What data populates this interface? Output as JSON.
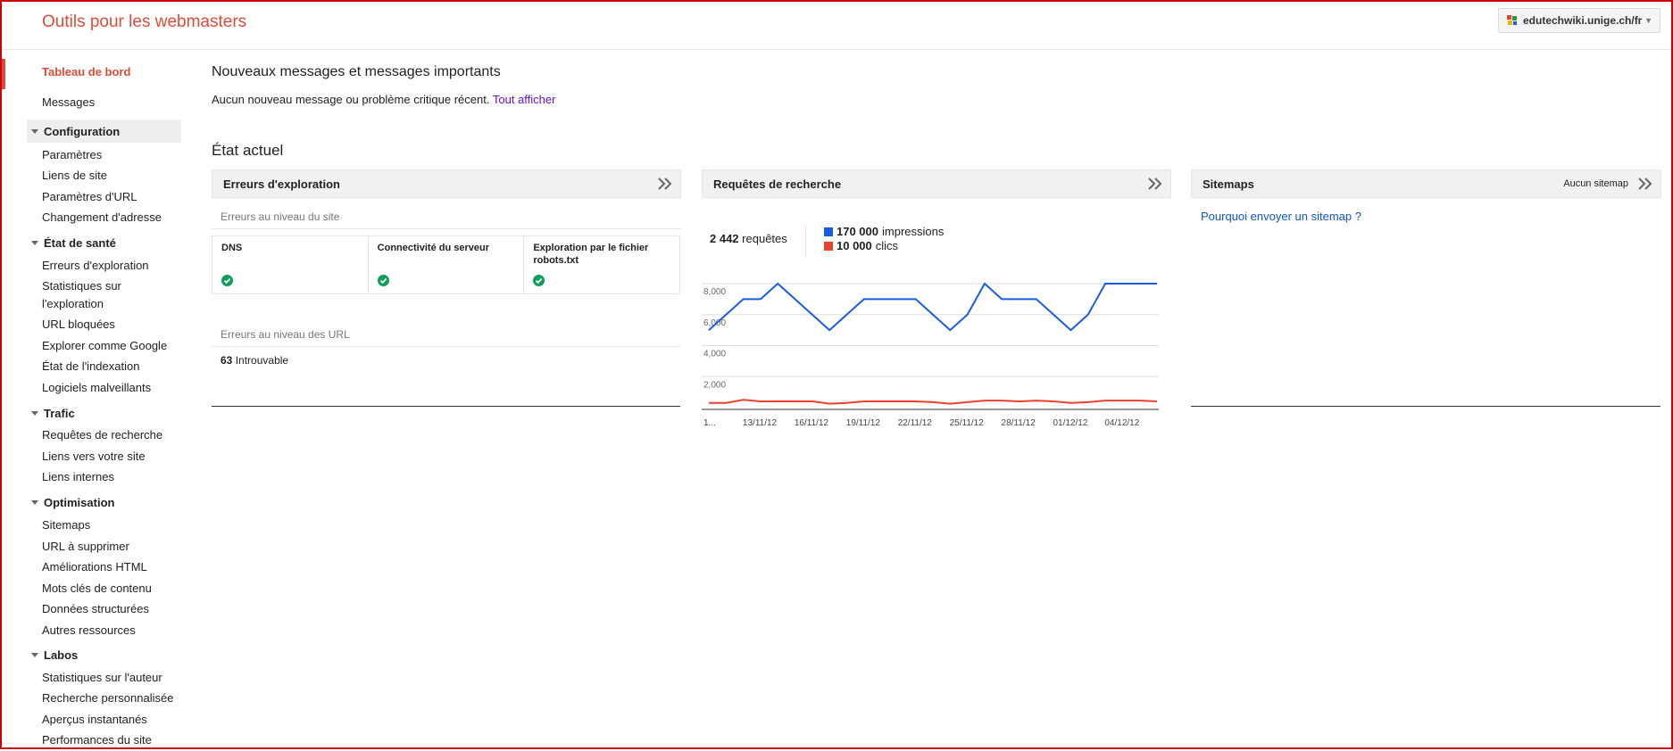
{
  "header": {
    "logo": "Outils pour les webmasters",
    "site": "edutechwiki.unige.ch/fr"
  },
  "sidebar": {
    "top_items": [
      {
        "label": "Tableau de bord",
        "active": true
      },
      {
        "label": "Messages"
      }
    ],
    "sections": [
      {
        "title": "Configuration",
        "selected": true,
        "items": [
          "Paramètres",
          "Liens de site",
          "Paramètres d'URL",
          "Changement d'adresse"
        ]
      },
      {
        "title": "État de santé",
        "items": [
          "Erreurs d'exploration",
          "Statistiques sur",
          "l'exploration",
          "URL bloquées",
          "Explorer comme Google",
          "État de l'indexation",
          "Logiciels malveillants"
        ]
      },
      {
        "title": "Trafic",
        "items": [
          "Requêtes de recherche",
          "Liens vers votre site",
          "Liens internes"
        ]
      },
      {
        "title": "Optimisation",
        "items": [
          "Sitemaps",
          "URL à supprimer",
          "Améliorations HTML",
          "Mots clés de contenu",
          "Données structurées",
          "Autres ressources"
        ]
      },
      {
        "title": "Labos",
        "items": [
          "Statistiques sur l'auteur",
          "Recherche personnalisée",
          "Aperçus instantanés",
          "Performances du site"
        ]
      }
    ]
  },
  "messages": {
    "heading": "Nouveaux messages et messages importants",
    "text": "Aucun nouveau message ou problème critique récent.",
    "link": "Tout afficher"
  },
  "state": {
    "heading": "État actuel"
  },
  "crawl_errors": {
    "title": "Erreurs d'exploration",
    "site_level_label": "Erreurs au niveau du site",
    "columns": [
      "DNS",
      "Connectivité du serveur",
      "Exploration par le fichier robots.txt"
    ],
    "url_level_label": "Erreurs au niveau des URL",
    "not_found_count": "63",
    "not_found_label": "Introuvable"
  },
  "search_queries": {
    "title": "Requêtes de recherche",
    "queries_count": "2 442",
    "queries_label": "requêtes",
    "impressions_value": "170 000",
    "impressions_label": "impressions",
    "clicks_value": "10 000",
    "clicks_label": "clics"
  },
  "sitemaps": {
    "title": "Sitemaps",
    "status": "Aucun sitemap",
    "link": "Pourquoi envoyer un sitemap ?"
  },
  "colors": {
    "brand": "#dd4b39",
    "impressions": "#1a5ce6",
    "clicks": "#e8432e",
    "link": "#1155cc",
    "visited_link": "#6611cc",
    "ok": "#0f9d58"
  },
  "chart_data": {
    "type": "line",
    "x": [
      "1...",
      "",
      "",
      "13/11/12",
      "",
      "",
      "16/11/12",
      "",
      "",
      "19/11/12",
      "",
      "",
      "22/11/12",
      "",
      "",
      "25/11/12",
      "",
      "",
      "28/11/12",
      "",
      "",
      "01/12/12",
      "",
      "",
      "04/12/12",
      "",
      ""
    ],
    "tick_labels": [
      "1...",
      "13/11/12",
      "16/11/12",
      "19/11/12",
      "22/11/12",
      "25/11/12",
      "28/11/12",
      "01/12/12",
      "04/12/12"
    ],
    "series": [
      {
        "name": "impressions",
        "values": [
          5000,
          6000,
          7000,
          7000,
          8000,
          7000,
          6000,
          5000,
          6000,
          7000,
          7000,
          7000,
          7000,
          6000,
          5000,
          6000,
          8000,
          7000,
          7000,
          7000,
          6000,
          5000,
          6000,
          8000,
          8000,
          8000,
          8000
        ]
      },
      {
        "name": "clics",
        "values": [
          300,
          300,
          500,
          400,
          400,
          400,
          400,
          250,
          300,
          400,
          400,
          400,
          400,
          350,
          250,
          350,
          450,
          450,
          400,
          450,
          400,
          300,
          350,
          450,
          450,
          450,
          400
        ]
      }
    ],
    "yticks": [
      "8,000",
      "6,000",
      "4,000",
      "2,000"
    ],
    "ylim": [
      0,
      8000
    ],
    "grid": true
  }
}
